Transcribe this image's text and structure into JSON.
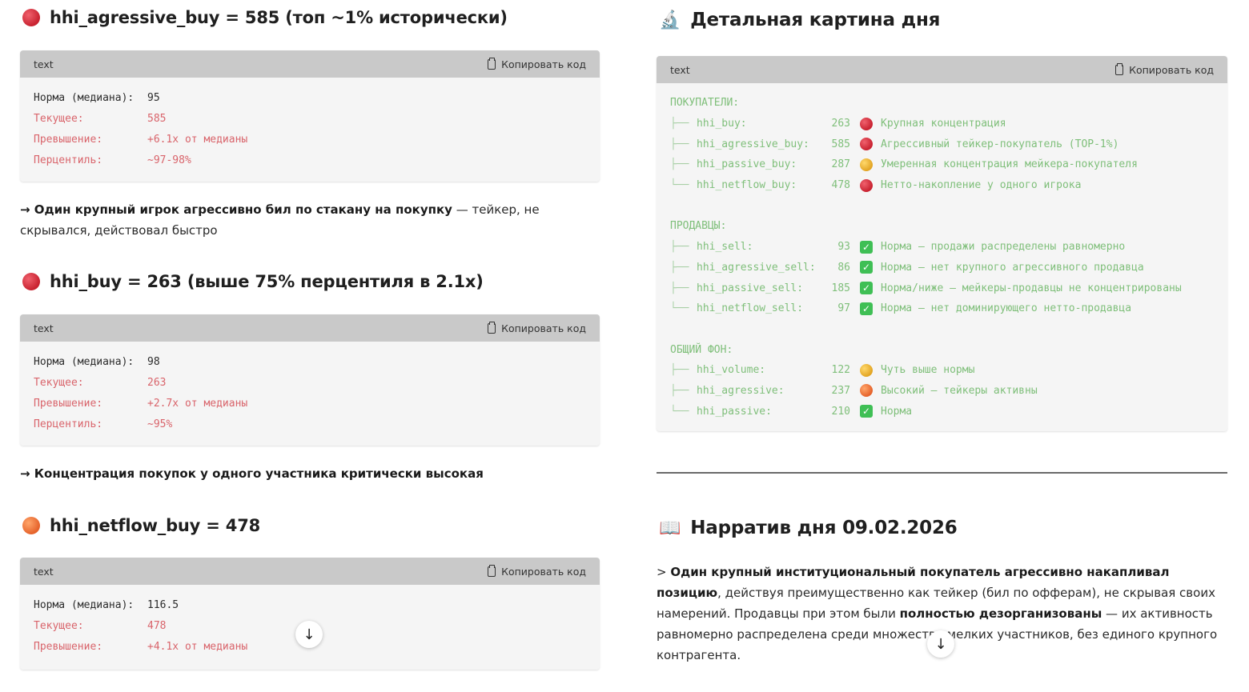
{
  "left": {
    "blocks": [
      {
        "heading": "hhi_agressive_buy = 585 (топ ~1% исторически)",
        "dot": "red",
        "code_lang": "text",
        "copy_label": "Копировать код",
        "rows": [
          {
            "k": "Норма (медиана):",
            "v": "95"
          },
          {
            "k": "Текущее:",
            "v": "585"
          },
          {
            "k": "Превышение:",
            "v": "+6.1x от медианы"
          },
          {
            "k": "Перцентиль:",
            "v": "~97-98%"
          }
        ],
        "note_bold": "→ Один крупный игрок агрессивно бил по стакану на покупку",
        "note_rest": " — тейкер, не скрывался, действовал быстро"
      },
      {
        "heading": "hhi_buy = 263 (выше 75% перцентиля в 2.1x)",
        "dot": "red",
        "code_lang": "text",
        "copy_label": "Копировать код",
        "rows": [
          {
            "k": "Норма (медиана):",
            "v": "98"
          },
          {
            "k": "Текущее:",
            "v": "263"
          },
          {
            "k": "Превышение:",
            "v": "+2.7x от медианы"
          },
          {
            "k": "Перцентиль:",
            "v": "~95%"
          }
        ],
        "note_bold": "→ Концентрация покупок у одного участника критически высокая",
        "note_rest": ""
      },
      {
        "heading": "hhi_netflow_buy = 478",
        "dot": "orange",
        "code_lang": "text",
        "copy_label": "Копировать код",
        "rows": [
          {
            "k": "Норма (медиана):",
            "v": "116.5"
          },
          {
            "k": "Текущее:",
            "v": "478"
          },
          {
            "k": "Превышение:",
            "v": "+4.1x от медианы"
          }
        ]
      }
    ]
  },
  "right": {
    "heading_icon": "microscope-icon",
    "heading": "Детальная картина дня",
    "code_lang": "text",
    "copy_label": "Копировать код",
    "sections": [
      {
        "title": "ПОКУПАТЕЛИ:",
        "items": [
          {
            "tree": "├──",
            "name": "hhi_buy:",
            "val": "263",
            "marker": "red",
            "desc": "Крупная концентрация"
          },
          {
            "tree": "├──",
            "name": "hhi_agressive_buy:",
            "val": "585",
            "marker": "red",
            "desc": "Агрессивный тейкер-покупатель (TOP-1%)"
          },
          {
            "tree": "├──",
            "name": "hhi_passive_buy:",
            "val": "287",
            "marker": "yellow",
            "desc": "Умеренная концентрация мейкера-покупателя"
          },
          {
            "tree": "└──",
            "name": "hhi_netflow_buy:",
            "val": "478",
            "marker": "red",
            "desc": "Нетто-накопление у одного игрока"
          }
        ]
      },
      {
        "title": "ПРОДАВЦЫ:",
        "items": [
          {
            "tree": "├──",
            "name": "hhi_sell:",
            "val": "93",
            "marker": "check",
            "desc": "Норма — продажи распределены равномерно"
          },
          {
            "tree": "├──",
            "name": "hhi_agressive_sell:",
            "val": "86",
            "marker": "check",
            "desc": "Норма — нет крупного агрессивного продавца"
          },
          {
            "tree": "├──",
            "name": "hhi_passive_sell:",
            "val": "185",
            "marker": "check",
            "desc": "Норма/ниже — мейкеры-продавцы не концентрированы"
          },
          {
            "tree": "└──",
            "name": "hhi_netflow_sell:",
            "val": "97",
            "marker": "check",
            "desc": "Норма — нет доминирующего нетто-продавца"
          }
        ]
      },
      {
        "title": "ОБЩИЙ ФОН:",
        "items": [
          {
            "tree": "├──",
            "name": "hhi_volume:",
            "val": "122",
            "marker": "yellow",
            "desc": "Чуть выше нормы"
          },
          {
            "tree": "├──",
            "name": "hhi_agressive:",
            "val": "237",
            "marker": "orange",
            "desc": "Высокий — тейкеры активны"
          },
          {
            "tree": "└──",
            "name": "hhi_passive:",
            "val": "210",
            "marker": "check",
            "desc": "Норма"
          }
        ]
      }
    ],
    "narrative_icon": "book-icon",
    "narrative_heading": "Нарратив дня 09.02.2026",
    "narrative": {
      "p1_prefix": "> ",
      "p1_bold": "Один крупный институциональный покупатель агрессивно накапливал позицию",
      "p1_rest": ", действуя преимущественно как тейкер (бил по офферам), не скрывая своих намерений. Продавцы при этом были ",
      "p2_bold": "полностью дезорганизованы",
      "p2_rest": " — их активность равномерно распределена среди множества мелких участников, без единого крупного контрагента."
    }
  },
  "scroll_arrow": "↓",
  "check_glyph": "✓"
}
